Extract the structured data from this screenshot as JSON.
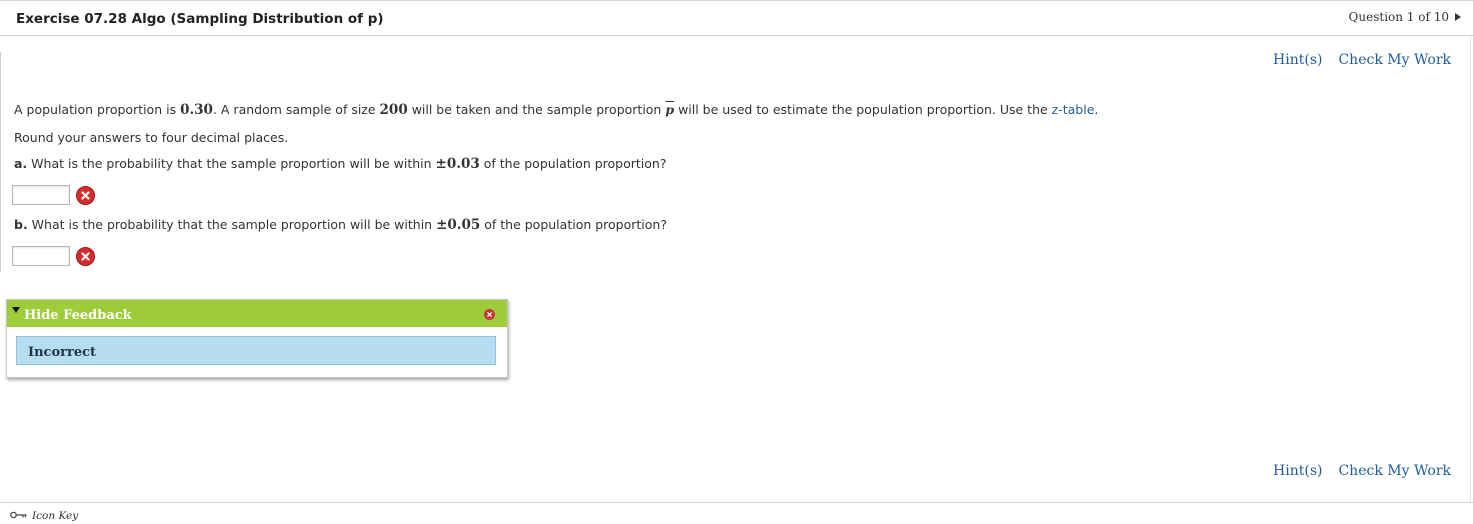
{
  "header": {
    "title": "Exercise 07.28 Algo (Sampling Distribution of p)",
    "question_label": "Question 1 of 10"
  },
  "toolbar": {
    "hints_label": "Hint(s)",
    "check_label": "Check My Work"
  },
  "problem": {
    "intro_1": "A population proportion is ",
    "population_proportion": "0.30",
    "intro_2": ". A random sample of size ",
    "sample_size": "200",
    "intro_3": " will be taken and the sample proportion ",
    "pbar_symbol": "p",
    "intro_4": " will be used to estimate the population proportion. Use the ",
    "table_link": "z-table",
    "intro_5": ".",
    "round_instruction": "Round your answers to four decimal places."
  },
  "questions": [
    {
      "letter": "a.",
      "text_before": " What is the probability that the sample proportion will be within ",
      "margin": "±0.03",
      "text_after": " of the population proportion?",
      "answer_value": ""
    },
    {
      "letter": "b.",
      "text_before": " What is the probability that the sample proportion will be within ",
      "margin": "±0.05",
      "text_after": " of the population proportion?",
      "answer_value": ""
    }
  ],
  "feedback": {
    "toggle_label": "Hide Feedback",
    "status": "Incorrect"
  },
  "footer": {
    "icon_key_label": "Icon Key"
  },
  "colors": {
    "link": "#1f5c99",
    "feedback_header": "#9ecc3b",
    "feedback_body": "#b5dcef",
    "error_icon": "#d42c2c"
  },
  "icons": [
    "next-question-icon",
    "incorrect-icon",
    "collapse-triangle-icon",
    "close-icon",
    "key-icon"
  ]
}
